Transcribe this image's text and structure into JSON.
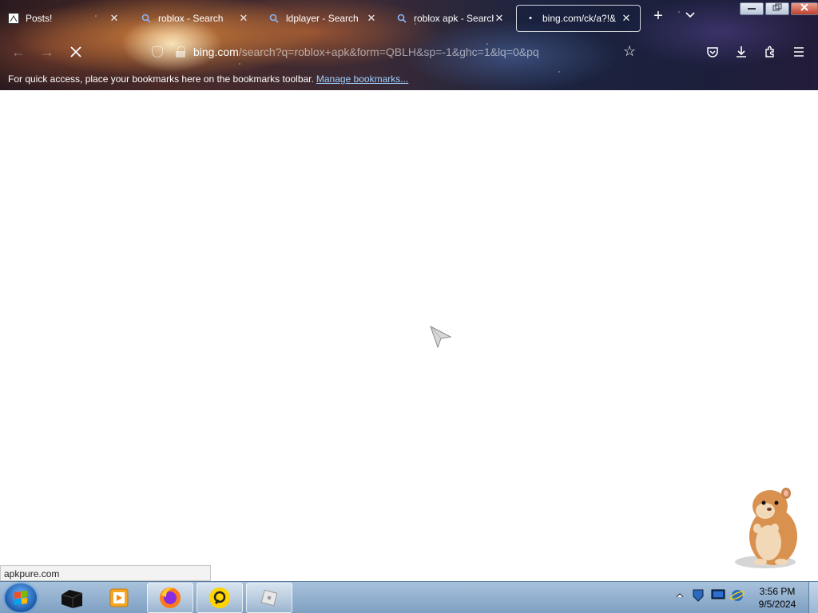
{
  "tabs": [
    {
      "title": "Posts!",
      "icon": "posts-favicon-icon"
    },
    {
      "title": "roblox - Search",
      "icon": "search-favicon-icon"
    },
    {
      "title": "ldplayer - Search",
      "icon": "search-favicon-icon"
    },
    {
      "title": "roblox apk - Search",
      "icon": "search-favicon-icon"
    },
    {
      "title": "bing.com/ck/a?!&",
      "icon": "loading-dot-icon",
      "active": true
    }
  ],
  "window_controls": {
    "minimize": "▭",
    "maximize": "🗗",
    "close": "✕"
  },
  "navbar": {
    "url_host": "bing.com",
    "url_path": "/search?q=roblox+apk&form=QBLH&sp=-1&ghc=1&lq=0&pq"
  },
  "bookmarks_bar": {
    "message": "For quick access, place your bookmarks here on the bookmarks toolbar.",
    "link": "Manage bookmarks..."
  },
  "status_bar": {
    "text": "apkpure.com"
  },
  "taskbar": {
    "apps": [
      "media-player-app",
      "firefox-app",
      "ldplayer-app",
      "roblox-app"
    ],
    "clock": {
      "time": "3:56 PM",
      "date": "9/5/2024"
    }
  },
  "colors": {
    "accent_link": "#9fd0ff",
    "taskbar": "#8fb0d0"
  }
}
